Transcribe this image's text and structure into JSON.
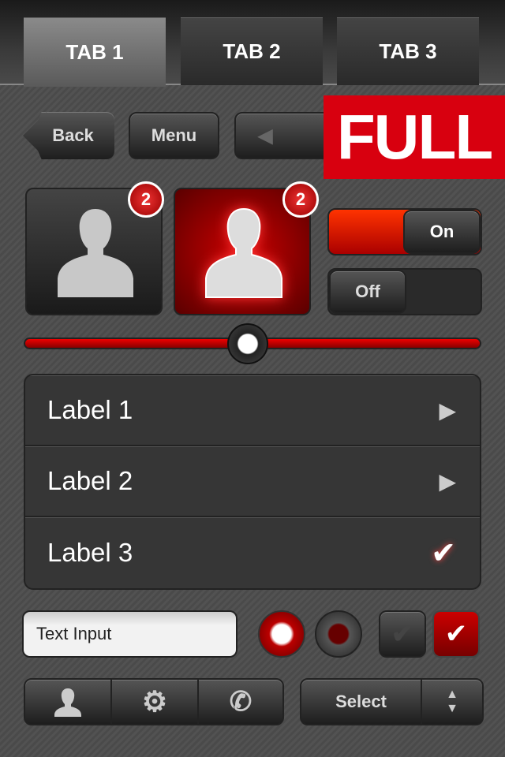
{
  "tabs": [
    {
      "label": "TAB 1",
      "active": true
    },
    {
      "label": "TAB 2",
      "active": false
    },
    {
      "label": "TAB 3",
      "active": false
    }
  ],
  "nav": {
    "back_label": "Back",
    "menu_label": "Menu"
  },
  "banner": {
    "text": "FULL",
    "color": "#d8000f"
  },
  "avatars": [
    {
      "badge": "2",
      "selected": false
    },
    {
      "badge": "2",
      "selected": true
    }
  ],
  "toggles": [
    {
      "label": "On",
      "state": true
    },
    {
      "label": "Off",
      "state": false
    }
  ],
  "slider": {
    "value_percent": 49,
    "accent": "#c00000"
  },
  "list": [
    {
      "label": "Label 1",
      "accessory": "chevron"
    },
    {
      "label": "Label 2",
      "accessory": "chevron"
    },
    {
      "label": "Label 3",
      "accessory": "checkmark"
    }
  ],
  "text_input": {
    "value": "Text Input"
  },
  "radios": [
    {
      "selected": true
    },
    {
      "selected": false
    }
  ],
  "checkboxes": [
    {
      "checked": false
    },
    {
      "checked": true
    }
  ],
  "toolbar": [
    "user-icon",
    "gear-icon",
    "phone-icon"
  ],
  "select": {
    "label": "Select"
  }
}
